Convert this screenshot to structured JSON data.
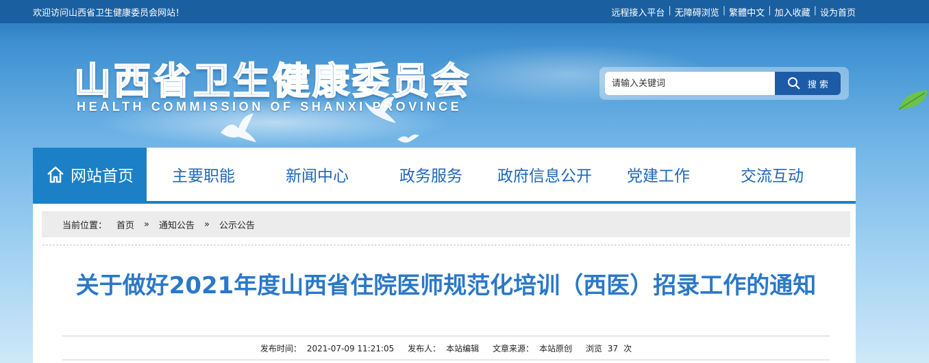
{
  "topbar": {
    "welcome": "欢迎访问山西省卫生健康委员会网站！",
    "links": [
      "远程接入平台",
      "无障碍浏览",
      "繁體中文",
      "加入收藏",
      "设为首页"
    ],
    "separator": "|"
  },
  "header": {
    "title": "山西省卫生健康委员会",
    "subtitle": "HEALTH COMMISSION OF SHANXI PROVINCE"
  },
  "search": {
    "placeholder": "请输入关键词",
    "button_label": "搜 索"
  },
  "nav": {
    "items": [
      "网站首页",
      "主要职能",
      "新闻中心",
      "政务服务",
      "政府信息公开",
      "党建工作",
      "交流互动"
    ]
  },
  "breadcrumb": {
    "label": "当前位置：",
    "items": [
      "首页",
      "通知公告",
      "公示公告"
    ],
    "separator": "»"
  },
  "article": {
    "title": "关于做好2021年度山西省住院医师规范化培训（西医）招录工作的通知",
    "publish_time_label": "发布时间：",
    "publish_time": "2021-07-09 11:21:05",
    "publisher_label": "发布人：",
    "publisher": "本站编辑",
    "source_label": "文章来源：",
    "source": "本站原创",
    "views_label": "浏览",
    "views": "37",
    "views_unit": "次"
  },
  "colors": {
    "topbar_bg": "#1a5fa0",
    "nav_active_bg": "#1b80c6",
    "nav_text": "#1d67b8",
    "title_text": "#2a78c8",
    "search_button_bg": "#1d5ba6"
  }
}
